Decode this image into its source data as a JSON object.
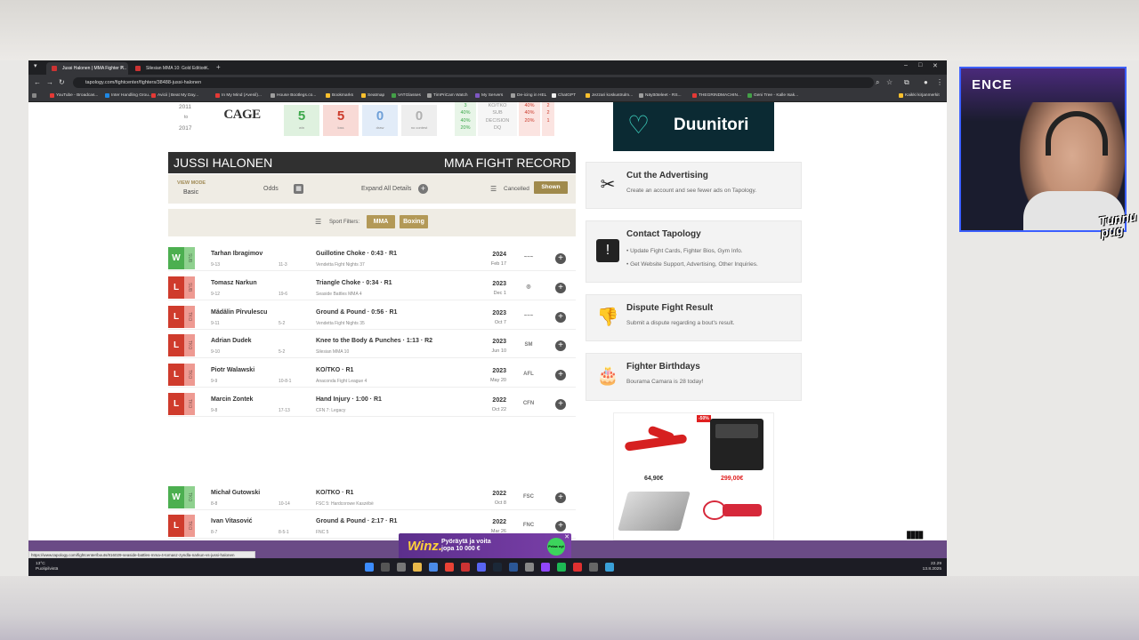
{
  "browser": {
    "tabs": [
      {
        "label": "Jussi Halonen | MMA Fighter P..."
      },
      {
        "label": "Silesian MMA 10: Gold Edition..."
      }
    ],
    "url": "tapology.com/fightcenter/fighters/38488-jussi-halonen",
    "bookmarks": [
      {
        "label": "YouTube - Broadcas...",
        "color": "#e53935"
      },
      {
        "label": "Inter Handling Grou...",
        "color": "#1e88e5"
      },
      {
        "label": "Avicii | Beat My Day...",
        "color": "#e53935"
      },
      {
        "label": "In My Mind (Avenil)...",
        "color": "#e53935"
      },
      {
        "label": "House Bootlegs.co...",
        "color": "#9e9e9e"
      },
      {
        "label": "Bookmarks",
        "color": "#fbc02d"
      },
      {
        "label": "Seatmap",
        "color": "#fbc02d"
      },
      {
        "label": "VATGlasses",
        "color": "#43a047"
      },
      {
        "label": "TimPriCam Watch",
        "color": "#9e9e9e"
      },
      {
        "label": "My Servers",
        "color": "#7e57c2"
      },
      {
        "label": "De-icing in HEL",
        "color": "#9e9e9e"
      },
      {
        "label": "ChatGPT",
        "color": "#eeeeee"
      },
      {
        "label": "Jezzari koskustrulm...",
        "color": "#fbc02d"
      },
      {
        "label": "Näyttöteleet - RS...",
        "color": "#9e9e9e"
      },
      {
        "label": "THEGRINDMACHIN...",
        "color": "#e53935"
      },
      {
        "label": "Geni Tree - Kalle Isak...",
        "color": "#43a047"
      }
    ],
    "all_bookmarks": "Kaikki kirjanmerkit",
    "status_url": "https://www.tapology.com/fightcenter/bouts/816029-seaside-battles-mma-4-tomasz-zyndla-narkun-vs-jussi-halonen"
  },
  "record": {
    "year_top": "2011",
    "year_to": "to",
    "year_bottom": "2017",
    "promo_logo": "CAGE",
    "stats": [
      {
        "value": "5",
        "label": "win",
        "color": "#3da84b",
        "bg": "#dff1df"
      },
      {
        "value": "5",
        "label": "loss",
        "color": "#cc3b2c",
        "bg": "#f8dad6"
      },
      {
        "value": "0",
        "label": "draw",
        "color": "#6fa0d8",
        "bg": "#e2ecf8"
      },
      {
        "value": "0",
        "label": "no contest",
        "color": "#b0b0b0",
        "bg": "#eeeeee"
      }
    ],
    "win_pcts": [
      "3",
      "40%",
      "2",
      "40%",
      "1",
      "20%"
    ],
    "loss_labels": [
      "KO/TKO",
      "SUB",
      "DECISION",
      "DQ"
    ],
    "loss_pcts": [
      "40%",
      "2",
      "40%",
      "2",
      "20%",
      "1"
    ]
  },
  "header": {
    "name": "JUSSI HALONEN",
    "record_title": "MMA FIGHT RECORD"
  },
  "viewbar": {
    "view_mode_label": "VIEW MODE",
    "view_mode_value": "Basic",
    "odds": "Odds",
    "expand": "Expand All Details",
    "cancelled": "Cancelled",
    "shown": "Shown"
  },
  "sportbar": {
    "label": "Sport Filters:",
    "mma": "MMA",
    "boxing": "Boxing"
  },
  "fights": [
    {
      "result": "W",
      "method": "SUB",
      "opponent": "Tarhan Ibragimov",
      "rec1": "9-13",
      "rec2": "11-3",
      "detail": "Guillotine Choke · 0:43 · R1",
      "event": "Vendetta Fight Nights 37",
      "year": "2024",
      "date": "Feb 17",
      "logo": "~~~"
    },
    {
      "result": "L",
      "method": "SUB",
      "opponent": "Tomasz Narkun",
      "rec1": "9-12",
      "rec2": "19-6",
      "detail": "Triangle Choke · 0:34 · R1",
      "event": "Seaside Battles MMA 4",
      "year": "2023",
      "date": "Dec 1",
      "logo": "◎"
    },
    {
      "result": "L",
      "method": "TKO",
      "opponent": "Mădălin Pîrvulescu",
      "rec1": "9-11",
      "rec2": "5-2",
      "detail": "Ground & Pound · 0:56 · R1",
      "event": "Vendetta Fight Nights 35",
      "year": "2023",
      "date": "Oct 7",
      "logo": "~~~"
    },
    {
      "result": "L",
      "method": "TKO",
      "opponent": "Adrian Dudek",
      "rec1": "9-10",
      "rec2": "5-2",
      "detail": "Knee to the Body & Punches · 1:13 · R2",
      "event": "Silesian MMA 10",
      "year": "2023",
      "date": "Jun 10",
      "logo": "SM"
    },
    {
      "result": "L",
      "method": "TKO",
      "opponent": "Piotr Walawski",
      "rec1": "9-9",
      "rec2": "10-8-1",
      "detail": "KO/TKO · R1",
      "event": "Anaconda Fight League 4",
      "year": "2023",
      "date": "May 20",
      "logo": "AFL"
    },
    {
      "result": "L",
      "method": "TKO",
      "opponent": "Marcin Zontek",
      "rec1": "9-8",
      "rec2": "17-13",
      "detail": "Hand Injury · 1:00 · R1",
      "event": "CFN 7: Legacy",
      "year": "2022",
      "date": "Oct 22",
      "logo": "CFN"
    },
    {
      "result": "W",
      "method": "TKO",
      "opponent": "Michał Gutowski",
      "rec1": "8-8",
      "rec2": "10-14",
      "detail": "KO/TKO · R1",
      "event": "FSC 5: Hardcorowe Kaszëbë",
      "year": "2022",
      "date": "Oct 8",
      "logo": "FSC"
    },
    {
      "result": "L",
      "method": "TKO",
      "opponent": "Ivan Vitasović",
      "rec1": "8-7",
      "rec2": "8-5-1",
      "detail": "Ground & Pound · 2:17 · R1",
      "event": "FNC 5",
      "year": "2022",
      "date": "Mar 26",
      "logo": "FNC"
    }
  ],
  "sidebar": {
    "ad_brand": "Duunitori",
    "cards": [
      {
        "title": "Cut the Advertising",
        "lines": [
          "Create an account and see fewer ads on Tapology."
        ],
        "icon": "scissors-icon"
      },
      {
        "title": "Contact Tapology",
        "lines": [
          "• Update Fight Cards, Fighter Bios, Gym Info.",
          "• Get Website Support, Advertising, Other Inquiries."
        ],
        "icon": "message-alert-icon"
      },
      {
        "title": "Dispute Fight Result",
        "lines": [
          "Submit a dispute regarding a bout's result."
        ],
        "icon": "thumbs-down-icon"
      },
      {
        "title": "Fighter Birthdays",
        "lines": [
          "Bourama Camara is 28 today!"
        ],
        "icon": "cake-icon"
      }
    ],
    "shop": {
      "price1": "64,90€",
      "price2": "299,00€",
      "sale": "-50%"
    }
  },
  "popup_ad": {
    "brand": "Winz.",
    "line1": "Pyöräytä ja voita",
    "line2": "jopa 10 000 €",
    "button": "Pelaa nyt"
  },
  "taskbar": {
    "temp": "13°C",
    "weather": "Puolipilvistä",
    "time": "22.29",
    "date": "13.8.2025"
  },
  "stream": {
    "logo": "ENCE",
    "watermark1": "Tunnu",
    "watermark2": "pug"
  }
}
